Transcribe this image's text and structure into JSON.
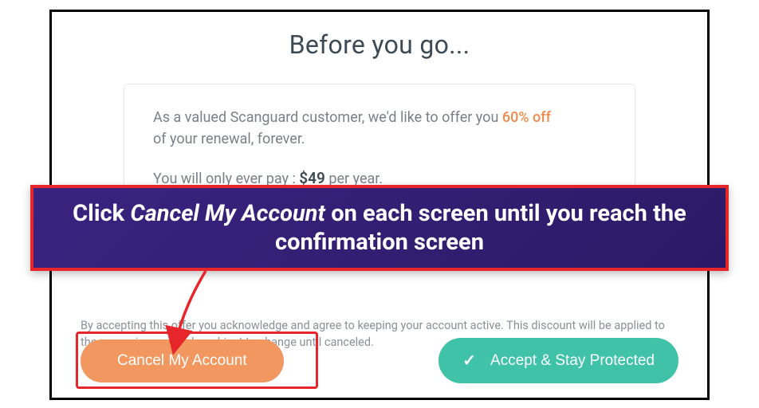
{
  "title": "Before you go...",
  "offer": {
    "line1_prefix": "As a valued Scanguard customer, we'd like to offer you ",
    "discount": "60% off",
    "line2": "of your renewal, forever.",
    "pay_prefix": "You will only ever pay : ",
    "price": "$49",
    "pay_suffix": " per year."
  },
  "disclaimer": "By accepting this offer you acknowledge and agree to keeping your account active. This discount will be applied to the upcoming renewals, subject to change until canceled.",
  "buttons": {
    "cancel": "Cancel My Account",
    "accept": "Accept & Stay Protected"
  },
  "annotation": {
    "text_before": "Click ",
    "em": "Cancel My Account",
    "text_after": " on each screen until you reach the confirmation screen"
  }
}
